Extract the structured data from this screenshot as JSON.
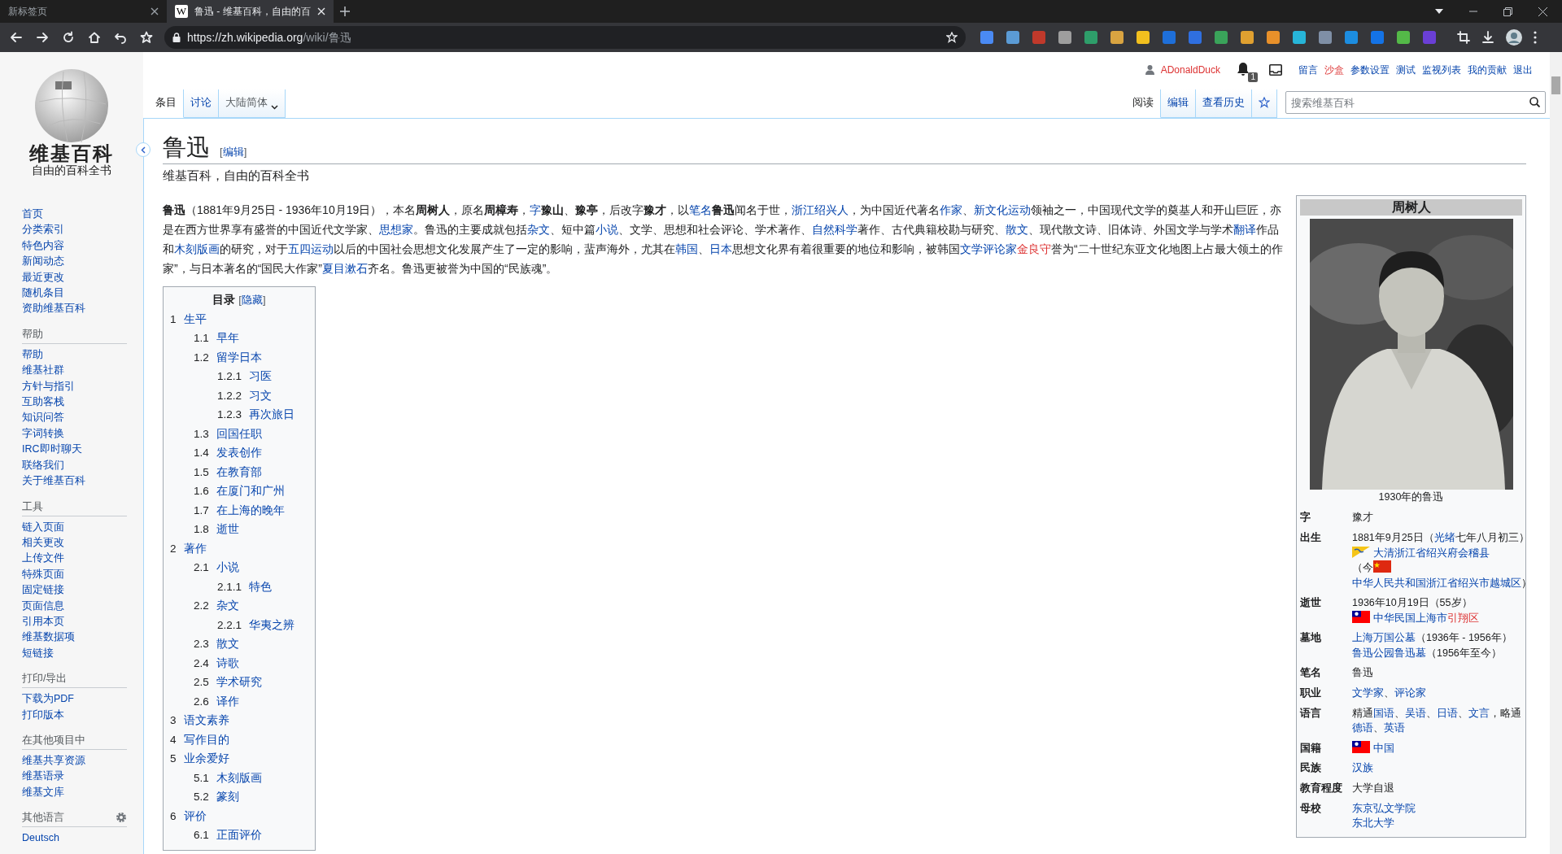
{
  "browser": {
    "tabs": [
      {
        "title": "新标签页",
        "selected": false
      },
      {
        "title": "鲁迅 - 维基百科，自由的百",
        "favicon": "W",
        "selected": true
      }
    ],
    "url_host": "https://zh.wikipedia.org",
    "url_path": "/wiki/鲁迅",
    "extensions": [
      {
        "color": "#4a8af4"
      },
      {
        "color": "#5b9bd5"
      },
      {
        "color": "#c0392b"
      },
      {
        "color": "#9e9e9e"
      },
      {
        "color": "#2e9e6a"
      },
      {
        "color": "#d9a441"
      },
      {
        "color": "#f2c01e"
      },
      {
        "color": "#1e6fd9"
      },
      {
        "color": "#2f6fe0"
      },
      {
        "color": "#3aa35a"
      },
      {
        "color": "#e0a030"
      },
      {
        "color": "#e8902a"
      },
      {
        "color": "#27b5d8"
      },
      {
        "color": "#7f8fa6"
      },
      {
        "color": "#1c8de0"
      },
      {
        "color": "#1473e6"
      },
      {
        "color": "#54b948"
      },
      {
        "color": "#6a3fd6"
      }
    ]
  },
  "logo": {
    "title": "维基百科",
    "tagline": "自由的百科全书"
  },
  "sidebar": {
    "main": [
      "首页",
      "分类索引",
      "特色内容",
      "新闻动态",
      "最近更改",
      "随机条目",
      "资助维基百科"
    ],
    "sections": [
      {
        "heading": "帮助",
        "gear": false,
        "items": [
          "帮助",
          "维基社群",
          "方针与指引",
          "互助客栈",
          "知识问答",
          "字词转换",
          "IRC即时聊天",
          "联络我们",
          "关于维基百科"
        ]
      },
      {
        "heading": "工具",
        "gear": false,
        "items": [
          "链入页面",
          "相关更改",
          "上传文件",
          "特殊页面",
          "固定链接",
          "页面信息",
          "引用本页",
          "维基数据项",
          "短链接"
        ]
      },
      {
        "heading": "打印/导出",
        "gear": false,
        "items": [
          "下载为PDF",
          "打印版本"
        ]
      },
      {
        "heading": "在其他项目中",
        "gear": false,
        "items": [
          "维基共享资源",
          "维基语录",
          "维基文库"
        ]
      },
      {
        "heading": "其他语言",
        "gear": true,
        "items": [
          "Deutsch"
        ]
      }
    ]
  },
  "user_bar": {
    "username": "ADonaldDuck",
    "notifications": "1",
    "links": [
      {
        "label": "留言",
        "red": false
      },
      {
        "label": "沙盒",
        "red": true
      },
      {
        "label": "参数设置",
        "red": false
      },
      {
        "label": "测试",
        "red": false
      },
      {
        "label": "监视列表",
        "red": false
      },
      {
        "label": "我的贡献",
        "red": false
      },
      {
        "label": "退出",
        "red": false
      }
    ]
  },
  "page_tabs": [
    {
      "label": "条目",
      "selected": true
    },
    {
      "label": "讨论",
      "selected": false
    }
  ],
  "variant": "大陆简体",
  "view_tabs": [
    {
      "label": "阅读",
      "selected": true
    },
    {
      "label": "编辑",
      "selected": false
    },
    {
      "label": "查看历史",
      "selected": false
    }
  ],
  "search": {
    "placeholder": "搜索维基百科"
  },
  "article": {
    "title": "鲁迅",
    "edit": {
      "open": "[",
      "label": "编辑",
      "close": "]"
    },
    "tagline": "维基百科，自由的百科全书",
    "intro": [
      {
        "kind": "bold",
        "text": "鲁迅"
      },
      {
        "kind": "text",
        "text": "（1881年9月25日 - 1936年10月19日），本名"
      },
      {
        "kind": "bold",
        "text": "周树人"
      },
      {
        "kind": "text",
        "text": "，原名"
      },
      {
        "kind": "bold",
        "text": "周樟寿"
      },
      {
        "kind": "text",
        "text": "，"
      },
      {
        "kind": "link",
        "text": "字"
      },
      {
        "kind": "bold",
        "text": "豫山"
      },
      {
        "kind": "text",
        "text": "、"
      },
      {
        "kind": "bold",
        "text": "豫亭"
      },
      {
        "kind": "text",
        "text": "，后改字"
      },
      {
        "kind": "bold",
        "text": "豫才"
      },
      {
        "kind": "text",
        "text": "，以"
      },
      {
        "kind": "link",
        "text": "笔名"
      },
      {
        "kind": "bold",
        "text": "鲁迅"
      },
      {
        "kind": "text",
        "text": "闻名于世，"
      },
      {
        "kind": "link",
        "text": "浙江绍兴人"
      },
      {
        "kind": "text",
        "text": "，为中国近代著名"
      },
      {
        "kind": "link",
        "text": "作家"
      },
      {
        "kind": "text",
        "text": "、"
      },
      {
        "kind": "link",
        "text": "新文化运动"
      },
      {
        "kind": "text",
        "text": "领袖之一，中国现代文学的奠基人和开山巨匠，亦是在西方世界享有盛誉的中国近代文学家、"
      },
      {
        "kind": "link",
        "text": "思想家"
      },
      {
        "kind": "text",
        "text": "。鲁迅的主要成就包括"
      },
      {
        "kind": "link",
        "text": "杂文"
      },
      {
        "kind": "text",
        "text": "、短中篇"
      },
      {
        "kind": "link",
        "text": "小说"
      },
      {
        "kind": "text",
        "text": "、文学、思想和社会评论、学术著作、"
      },
      {
        "kind": "link",
        "text": "自然科学"
      },
      {
        "kind": "text",
        "text": "著作、古代典籍校勘与研究、"
      },
      {
        "kind": "link",
        "text": "散文"
      },
      {
        "kind": "text",
        "text": "、现代散文诗、旧体诗、外国文学与学术"
      },
      {
        "kind": "link",
        "text": "翻译"
      },
      {
        "kind": "text",
        "text": "作品和"
      },
      {
        "kind": "link",
        "text": "木刻版画"
      },
      {
        "kind": "text",
        "text": "的研究，对于"
      },
      {
        "kind": "link",
        "text": "五四运动"
      },
      {
        "kind": "text",
        "text": "以后的中国社会思想文化发展产生了一定的影响，蜚声海外，尤其在"
      },
      {
        "kind": "link",
        "text": "韩国"
      },
      {
        "kind": "text",
        "text": "、"
      },
      {
        "kind": "link",
        "text": "日本"
      },
      {
        "kind": "text",
        "text": "思想文化界有着很重要的地位和影响，被韩国"
      },
      {
        "kind": "link",
        "text": "文学评论家"
      },
      {
        "kind": "red",
        "text": "金良守"
      },
      {
        "kind": "text",
        "text": "誉为“二十世纪东亚文化地图上占最大领土的作家”，与日本著名的“国民大作家”"
      },
      {
        "kind": "link",
        "text": "夏目漱石"
      },
      {
        "kind": "text",
        "text": "齐名。鲁迅更被誉为中国的“民族魂”。"
      }
    ],
    "toc": {
      "title": "目录",
      "toggle": {
        "open": "[",
        "label": "隐藏",
        "close": "]"
      },
      "items": [
        {
          "number": "1",
          "label": "生平",
          "children": [
            {
              "number": "1.1",
              "label": "早年"
            },
            {
              "number": "1.2",
              "label": "留学日本",
              "children": [
                {
                  "number": "1.2.1",
                  "label": "习医"
                },
                {
                  "number": "1.2.2",
                  "label": "习文"
                },
                {
                  "number": "1.2.3",
                  "label": "再次旅日"
                }
              ]
            },
            {
              "number": "1.3",
              "label": "回国任职"
            },
            {
              "number": "1.4",
              "label": "发表创作"
            },
            {
              "number": "1.5",
              "label": "在教育部"
            },
            {
              "number": "1.6",
              "label": "在厦门和广州"
            },
            {
              "number": "1.7",
              "label": "在上海的晚年"
            },
            {
              "number": "1.8",
              "label": "逝世"
            }
          ]
        },
        {
          "number": "2",
          "label": "著作",
          "children": [
            {
              "number": "2.1",
              "label": "小说",
              "children": [
                {
                  "number": "2.1.1",
                  "label": "特色"
                }
              ]
            },
            {
              "number": "2.2",
              "label": "杂文",
              "children": [
                {
                  "number": "2.2.1",
                  "label": "华夷之辨"
                }
              ]
            },
            {
              "number": "2.3",
              "label": "散文"
            },
            {
              "number": "2.4",
              "label": "诗歌"
            },
            {
              "number": "2.5",
              "label": "学术研究"
            },
            {
              "number": "2.6",
              "label": "译作"
            }
          ]
        },
        {
          "number": "3",
          "label": "语文素养"
        },
        {
          "number": "4",
          "label": "写作目的"
        },
        {
          "number": "5",
          "label": "业余爱好",
          "children": [
            {
              "number": "5.1",
              "label": "木刻版画"
            },
            {
              "number": "5.2",
              "label": "篆刻"
            }
          ]
        },
        {
          "number": "6",
          "label": "评价",
          "children": [
            {
              "number": "6.1",
              "label": "正面评价"
            }
          ]
        }
      ]
    },
    "infobox": {
      "title": "周树人",
      "caption": "1930年的鲁迅",
      "rows": [
        {
          "label": "字",
          "lines": [
            [
              {
                "kind": "text",
                "text": "豫才"
              }
            ]
          ]
        },
        {
          "label": "出生",
          "lines": [
            [
              {
                "kind": "text",
                "text": "1881年9月25日（"
              },
              {
                "kind": "link",
                "text": "光绪"
              },
              {
                "kind": "text",
                "text": "七年八月初三）"
              }
            ],
            [
              {
                "kind": "dragonflag"
              },
              {
                "kind": "link",
                "text": "大清浙江省绍兴府会稽县"
              }
            ],
            [
              {
                "kind": "text",
                "text": "（今"
              },
              {
                "kind": "starflag"
              },
              {
                "kind": "link",
                "text": "中华人民共和国浙江省绍兴市越城区"
              },
              {
                "kind": "text",
                "text": "）"
              }
            ]
          ]
        },
        {
          "label": "逝世",
          "lines": [
            [
              {
                "kind": "text",
                "text": "1936年10月19日（55岁）"
              }
            ],
            [
              {
                "kind": "sunflag"
              },
              {
                "kind": "link",
                "text": "中华民国上海市"
              },
              {
                "kind": "red",
                "text": "引翔区"
              }
            ]
          ]
        },
        {
          "label": "墓地",
          "lines": [
            [
              {
                "kind": "link",
                "text": "上海万国公墓"
              },
              {
                "kind": "text",
                "text": "（1936年 - 1956年）"
              }
            ],
            [
              {
                "kind": "link",
                "text": "鲁迅公园鲁迅墓"
              },
              {
                "kind": "text",
                "text": "（1956年至今）"
              }
            ]
          ]
        },
        {
          "label": "笔名",
          "lines": [
            [
              {
                "kind": "text",
                "text": "鲁迅"
              }
            ]
          ]
        },
        {
          "label": "职业",
          "lines": [
            [
              {
                "kind": "link",
                "text": "文学家"
              },
              {
                "kind": "text",
                "text": "、"
              },
              {
                "kind": "link",
                "text": "评论家"
              }
            ]
          ]
        },
        {
          "label": "语言",
          "lines": [
            [
              {
                "kind": "text",
                "text": "精通"
              },
              {
                "kind": "link",
                "text": "国语"
              },
              {
                "kind": "text",
                "text": "、"
              },
              {
                "kind": "link",
                "text": "吴语"
              },
              {
                "kind": "text",
                "text": "、"
              },
              {
                "kind": "link",
                "text": "日语"
              },
              {
                "kind": "text",
                "text": "、"
              },
              {
                "kind": "link",
                "text": "文言"
              },
              {
                "kind": "text",
                "text": "，略通"
              },
              {
                "kind": "link",
                "text": "德语"
              },
              {
                "kind": "text",
                "text": "、"
              },
              {
                "kind": "link",
                "text": "英语"
              }
            ]
          ]
        },
        {
          "label": "国籍",
          "lines": [
            [
              {
                "kind": "sunflag"
              },
              {
                "kind": "link",
                "text": "中国"
              }
            ]
          ]
        },
        {
          "label": "民族",
          "lines": [
            [
              {
                "kind": "link",
                "text": "汉族"
              }
            ]
          ]
        },
        {
          "label": "教育程度",
          "lines": [
            [
              {
                "kind": "text",
                "text": "大学自退"
              }
            ]
          ]
        },
        {
          "label": "母校",
          "lines": [
            [
              {
                "kind": "link",
                "text": "东京弘文学院"
              }
            ],
            [
              {
                "kind": "link",
                "text": "东北大学"
              }
            ]
          ]
        }
      ]
    }
  }
}
